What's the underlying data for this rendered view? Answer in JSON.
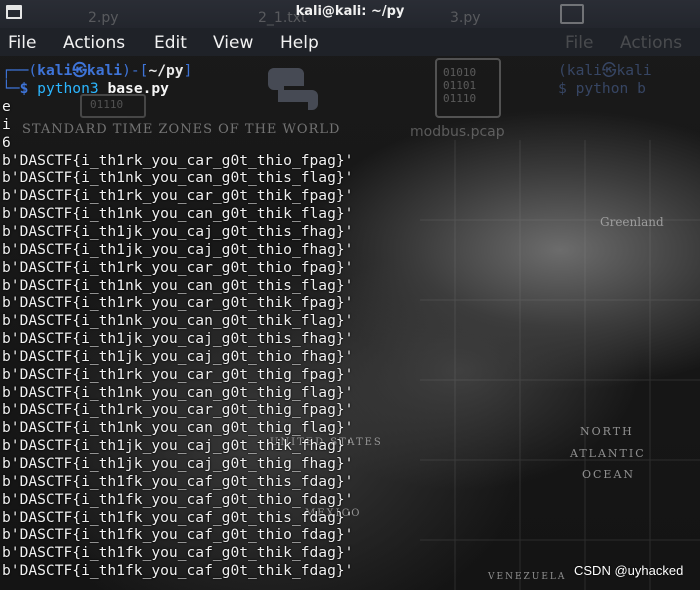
{
  "window": {
    "title": "kali@kali: ~/py",
    "ghost_tabs": [
      "2.py",
      "2_1.txt",
      "3.py"
    ]
  },
  "menu": {
    "items": [
      "File",
      "Actions",
      "Edit",
      "View",
      "Help"
    ],
    "ghost_items": [
      "File",
      "Actions"
    ]
  },
  "desktop": {
    "map_title": "STANDARD TIME ZONES OF THE WORLD",
    "file_label": "modbus.pcap",
    "binary_icon_text": [
      "01010",
      "01101",
      "01110"
    ],
    "map_labels": [
      "NORTH",
      "ATLANTIC",
      "OCEAN",
      "Greenland",
      "MEXICO",
      "VENEZUELA",
      "UNITED STATES"
    ]
  },
  "terminal": {
    "prompt": {
      "user": "kali",
      "host": "kali",
      "at_symbol": "㉿",
      "dir": "~/py",
      "command": "python3",
      "argument": "base.py"
    },
    "ghost_prompt": {
      "user_host": "(kali㉿kali",
      "command": "$ python b"
    },
    "output_lines": [
      "e",
      "i",
      "6",
      "b'DASCTF{i_th1rk_you_car_g0t_thio_fpag}'",
      "b'DASCTF{i_th1nk_you_can_g0t_this_flag}'",
      "b'DASCTF{i_th1rk_you_car_g0t_thik_fpag}'",
      "b'DASCTF{i_th1nk_you_can_g0t_thik_flag}'",
      "b'DASCTF{i_th1jk_you_caj_g0t_this_fhag}'",
      "b'DASCTF{i_th1jk_you_caj_g0t_thio_fhag}'",
      "b'DASCTF{i_th1rk_you_car_g0t_thio_fpag}'",
      "b'DASCTF{i_th1nk_you_can_g0t_this_flag}'",
      "b'DASCTF{i_th1rk_you_car_g0t_thik_fpag}'",
      "b'DASCTF{i_th1nk_you_can_g0t_thik_flag}'",
      "b'DASCTF{i_th1jk_you_caj_g0t_this_fhag}'",
      "b'DASCTF{i_th1jk_you_caj_g0t_thio_fhag}'",
      "b'DASCTF{i_th1rk_you_car_g0t_thig_fpag}'",
      "b'DASCTF{i_th1nk_you_can_g0t_thig_flag}'",
      "b'DASCTF{i_th1rk_you_car_g0t_thig_fpag}'",
      "b'DASCTF{i_th1nk_you_can_g0t_thig_flag}'",
      "b'DASCTF{i_th1jk_you_caj_g0t_thik_fhag}'",
      "b'DASCTF{i_th1jk_you_caj_g0t_thig_fhag}'",
      "b'DASCTF{i_th1fk_you_caf_g0t_this_fdag}'",
      "b'DASCTF{i_th1fk_you_caf_g0t_thio_fdag}'",
      "b'DASCTF{i_th1fk_you_caf_g0t_this_fdag}'",
      "b'DASCTF{i_th1fk_you_caf_g0t_thio_fdag}'",
      "b'DASCTF{i_th1fk_you_caf_g0t_thik_fdag}'",
      "b'DASCTF{i_th1fk_you_caf_g0t_thik_fdag}'"
    ]
  },
  "watermark": "CSDN @uyhacked",
  "colors": {
    "prompt_blue": "#3e74d8",
    "command_cyan": "#2bb6ff",
    "text": "#f1f1f1"
  }
}
